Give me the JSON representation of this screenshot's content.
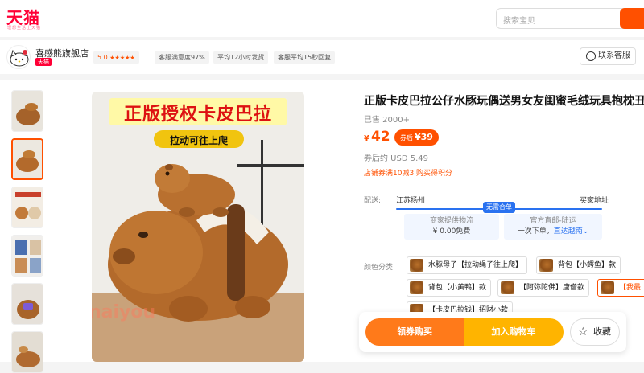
{
  "header": {
    "logo": "天猫",
    "logo_tagline": "理想生活上天猫",
    "search_placeholder": "搜索宝贝"
  },
  "shop": {
    "name": "喜感熊旗舰店",
    "badge": "天猫",
    "score": "5.0",
    "stars": "★★★★★",
    "satisfaction": "客服满意度97%",
    "ship_time": "平均12小时发货",
    "reply_time": "客服平均15秒回复",
    "service_label": "联系客服"
  },
  "gallery": {
    "main_title": "正版授权卡皮巴拉",
    "main_sub": "拉动可往上爬",
    "watermark": "naiyou"
  },
  "product": {
    "title": "正版卡皮巴拉公仔水豚玩偶送男女友闺蜜毛绒玩具抱枕丑萌",
    "sold": "已售 2000+",
    "currency": "¥",
    "price": "42",
    "coupon_label": "券后",
    "coupon_price": "¥39",
    "usd": "券后约 USD 5.49",
    "promo": "店铺券满10减3 购买得积分"
  },
  "shipping": {
    "label": "配送:",
    "from": "江苏扬州",
    "to": "买家地址",
    "tag": "无需合单",
    "box1_title": "商家提供物流",
    "box1_value": "¥ 0.00免费",
    "box2_title": "官方直邮-陆运",
    "box2_value_a": "一次下单，",
    "box2_value_b": "直达越南",
    "chevron": "⌄"
  },
  "options": {
    "label": "颜色分类:",
    "items": [
      "水豚母子【拉动绳子往上爬】",
      "背包【小鳄鱼】款",
      "背包【小黄鸭】款",
      "【阿弥陀佛】唐僧款",
      "【我最…",
      "【卡皮巴拉钱】招财小款"
    ]
  },
  "actions": {
    "buy": "领券购买",
    "cart": "加入购物车",
    "fav": "收藏",
    "fav_icon": "☆"
  }
}
